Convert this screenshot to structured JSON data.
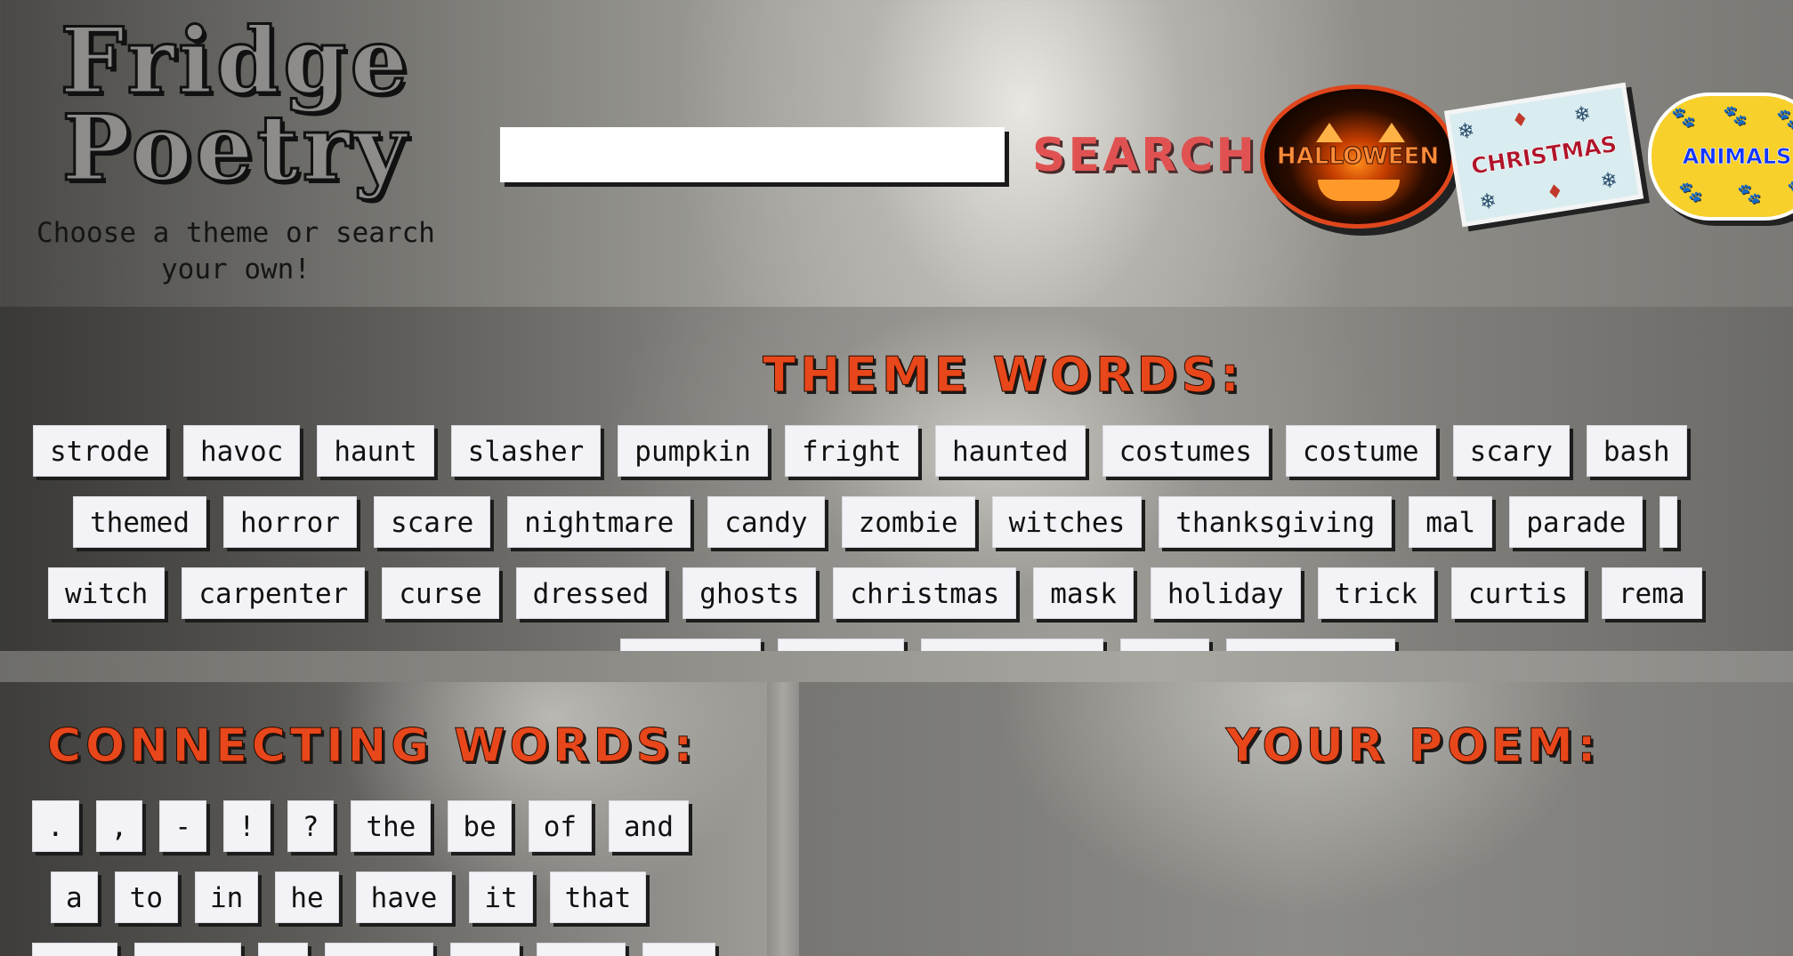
{
  "header": {
    "title_line1": "Fridge",
    "title_line2": "Poetry",
    "tagline_line1": "Choose a theme or search",
    "tagline_line2": "your own!",
    "search_value": "",
    "search_button": "SEARCH",
    "themes": {
      "halloween": "HALLOWEEN",
      "christmas": "CHRISTMAS",
      "animals": "ANIMALS"
    }
  },
  "theme_words": {
    "heading": "THEME WORDS:",
    "rows": [
      [
        "strode",
        "havoc",
        "haunt",
        "slasher",
        "pumpkin",
        "fright",
        "haunted",
        "costumes",
        "costume",
        "scary",
        "bash"
      ],
      [
        "themed",
        "horror",
        "scare",
        "nightmare",
        "candy",
        "zombie",
        "witches",
        "thanksgiving",
        "mal",
        "parade"
      ],
      [
        "witch",
        "carpenter",
        "curse",
        "dressed",
        "ghosts",
        "christmas",
        "mask",
        "holiday",
        "trick",
        "curtis",
        "rema"
      ]
    ]
  },
  "connecting_words": {
    "heading": "CONNECTING WORDS:",
    "rows": [
      [
        ".",
        ",",
        "-",
        "!",
        "?",
        "the",
        "be",
        "of",
        "and"
      ],
      [
        "a",
        "to",
        "in",
        "he",
        "have",
        "it",
        "that"
      ]
    ]
  },
  "poem": {
    "heading": "YOUR POEM:"
  },
  "colors": {
    "accent_orange": "#e8471b",
    "search_red": "#e05252",
    "tile_bg": "#f3f3f7"
  }
}
